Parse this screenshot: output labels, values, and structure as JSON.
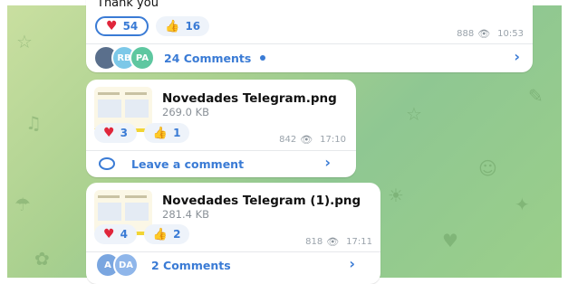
{
  "messages": [
    {
      "caption_partial": "Thank you",
      "reactions": [
        {
          "icon": "heart-icon",
          "count": "54",
          "selected": true
        },
        {
          "icon": "thumbs-up-icon",
          "count": "16",
          "selected": false
        }
      ],
      "views": "888",
      "time": "10:53",
      "comments": {
        "avatars": [
          {
            "initials": "",
            "color": "#5a6f8c"
          },
          {
            "initials": "RB",
            "color": "#7cc8e8"
          },
          {
            "initials": "PA",
            "color": "#5ec7a0"
          }
        ],
        "label": "24 Comments",
        "unread_dot": true
      }
    },
    {
      "file_name": "Novedades Telegram.png",
      "file_size": "269.0 KB",
      "reactions": [
        {
          "icon": "heart-icon",
          "count": "3",
          "selected": false
        },
        {
          "icon": "thumbs-up-icon",
          "count": "1",
          "selected": false
        }
      ],
      "views": "842",
      "time": "17:10",
      "comments": {
        "label": "Leave a comment"
      }
    },
    {
      "file_name": "Novedades Telegram (1).png",
      "file_size": "281.4 KB",
      "reactions": [
        {
          "icon": "heart-icon",
          "count": "4",
          "selected": false
        },
        {
          "icon": "thumbs-up-icon",
          "count": "2",
          "selected": false
        }
      ],
      "views": "818",
      "time": "17:11",
      "comments": {
        "avatars": [
          {
            "initials": "A",
            "color": "#7aa6e0"
          },
          {
            "initials": "DA",
            "color": "#8fb6ea"
          }
        ],
        "label": "2 Comments"
      }
    }
  ],
  "colors": {
    "accent": "#3a7bd5",
    "heart": "#e0263b",
    "thumb": "#f0a81e",
    "meta": "#9aa3ab"
  }
}
